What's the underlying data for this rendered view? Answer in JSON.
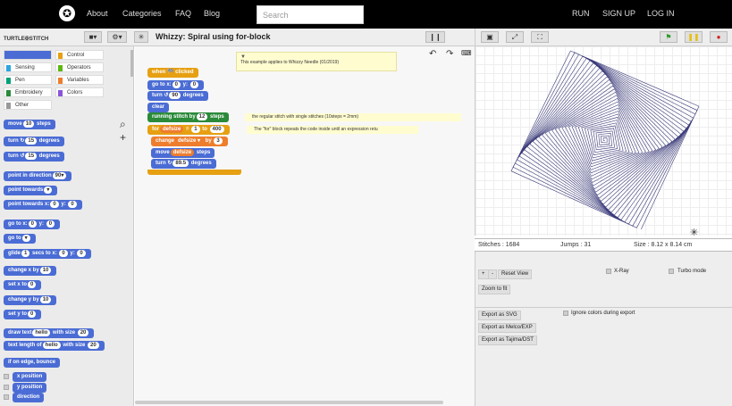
{
  "nav": {
    "logo_glyph": "✪",
    "about": "About",
    "categories": "Categories",
    "faq": "FAQ",
    "blog": "Blog",
    "search_placeholder": "Search",
    "run": "RUN",
    "signup": "SIGN UP",
    "login": "LOG IN"
  },
  "toolbar": {
    "logo_a": "TURTLE",
    "logo_b": "STITCH",
    "file_icon": "file-icon",
    "settings_icon": "gear-icon",
    "turtle_icon": "turtle-icon",
    "title": "Whizzy: Spiral using for-block",
    "footprints_icon": "footprints-icon"
  },
  "categories": [
    {
      "label": "Motion",
      "color": "#4a6cd4"
    },
    {
      "label": "Control",
      "color": "#e6a012"
    },
    {
      "label": "Sensing",
      "color": "#2ca5e2"
    },
    {
      "label": "Operators",
      "color": "#5cb712"
    },
    {
      "label": "Pen",
      "color": "#00a178"
    },
    {
      "label": "Variables",
      "color": "#ee7d2d"
    },
    {
      "label": "Embroidery",
      "color": "#2a8a3a"
    },
    {
      "label": "Colors",
      "color": "#8a55d7"
    },
    {
      "label": "Other",
      "color": "#999999"
    }
  ],
  "palette": {
    "move": [
      "move",
      "10",
      "steps"
    ],
    "turn_r": [
      "turn ↻",
      "15",
      "degrees"
    ],
    "turn_l": [
      "turn ↺",
      "15",
      "degrees"
    ],
    "point_dir": [
      "point in direction",
      "90▾"
    ],
    "point_towards": [
      "point towards",
      "▾"
    ],
    "point_xy": [
      "point towards x:",
      "0",
      "y:",
      "0"
    ],
    "goto_xy": [
      "go to x:",
      "0",
      "y:",
      "0"
    ],
    "goto": [
      "go to",
      "▾"
    ],
    "glide": [
      "glide",
      "1",
      "secs to x:",
      "0",
      "y:",
      "0"
    ],
    "change_x": [
      "change x by",
      "10"
    ],
    "set_x": [
      "set x to",
      "0"
    ],
    "change_y": [
      "change y by",
      "10"
    ],
    "set_y": [
      "set y to",
      "0"
    ],
    "draw_text": [
      "draw text",
      "hello",
      "with size",
      "20"
    ],
    "text_len": [
      "text length of",
      "hello",
      "with size",
      "20"
    ],
    "bounce": "if on edge, bounce",
    "xpos": "x position",
    "ypos": "y position",
    "direction": "direction"
  },
  "script": {
    "hat": "when 🏁 clicked",
    "goto": [
      "go to x:",
      "0",
      "y:",
      "0"
    ],
    "turn": [
      "turn ↺",
      "90",
      "degrees"
    ],
    "clear": "clear",
    "running": [
      "running stitch by",
      "12",
      "steps"
    ],
    "for": [
      "for",
      "defsize",
      "=",
      "1",
      "to",
      "400"
    ],
    "change": [
      "change",
      "defsize ▾",
      "by",
      "3"
    ],
    "move": [
      "move",
      "defsize",
      "steps"
    ],
    "turn2": [
      "turn ↻",
      "89.5",
      "degrees"
    ],
    "note": "This example applies to Whizzy Needle (01/2019)",
    "comment1": "the regular stitch with single stitches (10steps = 2mm)",
    "comment2": "The \"for\" block repeats the code inside until an expression retu"
  },
  "stats": {
    "stitches": "Stitches : 1684",
    "jumps": "Jumps : 31",
    "size": "Size : 8.12 x 8.14 cm"
  },
  "controls": {
    "plus": "+",
    "minus": "-",
    "reset": "Reset View",
    "zoomfit": "Zoom to fit",
    "xray": "X-Ray",
    "turbo": "Turbo mode",
    "svg": "Export as SVG",
    "melco": "Export as Melco/EXP",
    "tajima": "Export as Tajima/DST",
    "ignore": "Ignore colors during export"
  },
  "colors": {
    "motion": "#4a6cd4",
    "control": "#e6a012",
    "stitch": "#2a8a3a",
    "thread": "#3a3a7a"
  }
}
